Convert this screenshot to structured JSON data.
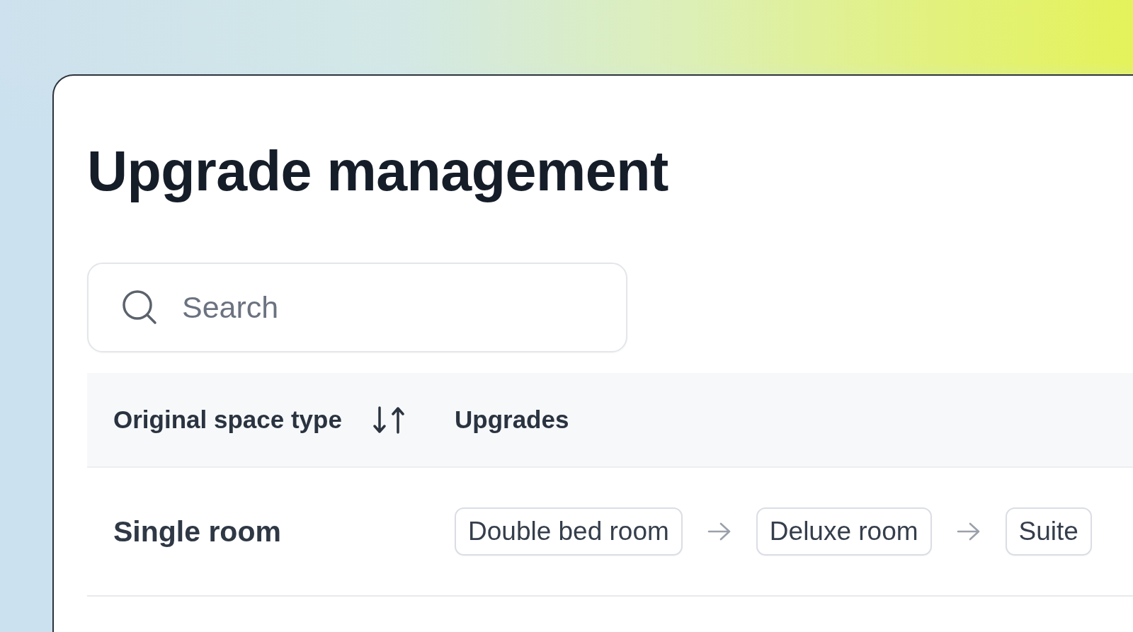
{
  "page": {
    "title": "Upgrade management"
  },
  "search": {
    "placeholder": "Search"
  },
  "table": {
    "columns": [
      {
        "label": "Original space type",
        "sortable": true
      },
      {
        "label": "Upgrades",
        "sortable": false
      }
    ],
    "rows": [
      {
        "original_space_type": "Single room",
        "upgrades": [
          "Double bed room",
          "Deluxe room",
          "Suite"
        ]
      }
    ]
  }
}
